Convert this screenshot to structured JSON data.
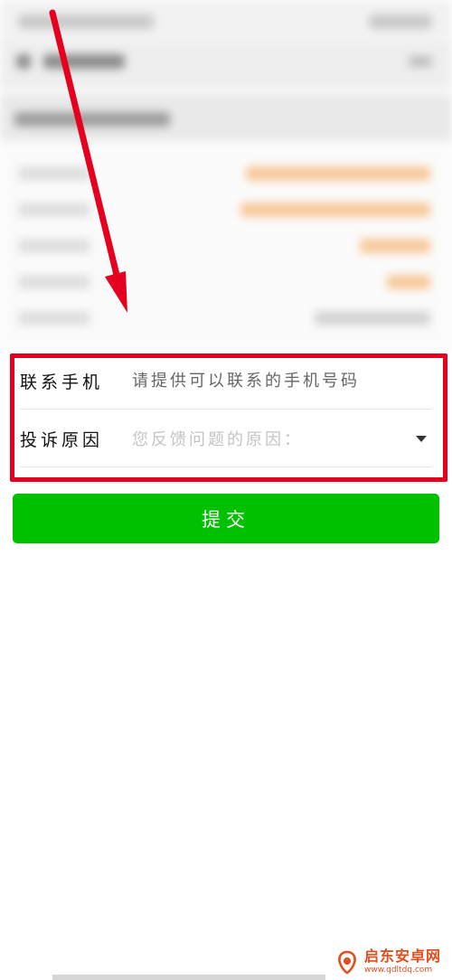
{
  "form": {
    "phone_label": "联系手机",
    "phone_placeholder": "请提供可以联系的手机号码",
    "reason_label": "投诉原因",
    "reason_value": "您反馈问题的原因："
  },
  "submit": {
    "label": "提交"
  },
  "annotation": {
    "arrow_color": "#e5001f",
    "box_color": "#e5001f"
  },
  "watermark": {
    "title": "启东安卓网",
    "url": "www.qdltdq.com"
  },
  "colors": {
    "submit_bg": "#00c100",
    "watermark": "#e14d1c"
  }
}
